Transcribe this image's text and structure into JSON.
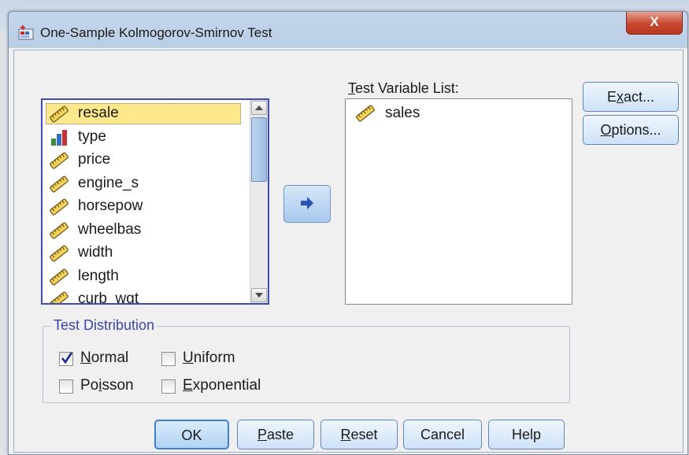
{
  "window": {
    "title": "One-Sample Kolmogorov-Smirnov Test",
    "close_label": "X"
  },
  "source_list": {
    "items": [
      {
        "label": "resale",
        "icon": "scale-ruler-icon",
        "selected": true
      },
      {
        "label": "type",
        "icon": "bar-nominal-icon",
        "selected": false
      },
      {
        "label": "price",
        "icon": "scale-ruler-icon",
        "selected": false
      },
      {
        "label": "engine_s",
        "icon": "scale-ruler-icon",
        "selected": false
      },
      {
        "label": "horsepow",
        "icon": "scale-ruler-icon",
        "selected": false
      },
      {
        "label": "wheelbas",
        "icon": "scale-ruler-icon",
        "selected": false
      },
      {
        "label": "width",
        "icon": "scale-ruler-icon",
        "selected": false
      },
      {
        "label": "length",
        "icon": "scale-ruler-icon",
        "selected": false
      },
      {
        "label": "curb_wgt",
        "icon": "scale-ruler-icon",
        "selected": false
      }
    ]
  },
  "move_button": {
    "icon": "right-arrow-icon"
  },
  "target": {
    "label_mnemonic": "T",
    "label_rest": "est Variable List:",
    "items": [
      {
        "label": "sales",
        "icon": "scale-ruler-icon"
      }
    ]
  },
  "side_buttons": {
    "exact_pre": "E",
    "exact_mn": "x",
    "exact_post": "act...",
    "options_mn": "O",
    "options_post": "ptions..."
  },
  "distribution": {
    "title": "Test Distribution",
    "normal": {
      "mn": "N",
      "rest": "ormal",
      "checked": true
    },
    "uniform": {
      "mn": "U",
      "rest": "niform",
      "checked": false
    },
    "poisson": {
      "pre": "Po",
      "mn": "i",
      "post": "sson",
      "checked": false
    },
    "exponential": {
      "mn": "E",
      "rest": "xponential",
      "checked": false
    }
  },
  "buttons": {
    "ok": "OK",
    "paste_mn": "P",
    "paste_rest": "aste",
    "reset_mn": "R",
    "reset_rest": "eset",
    "cancel": "Cancel",
    "help": "Help"
  },
  "colors": {
    "accent": "#3c4bb8",
    "selection": "#fde98c",
    "group_title": "#3a47a8"
  }
}
